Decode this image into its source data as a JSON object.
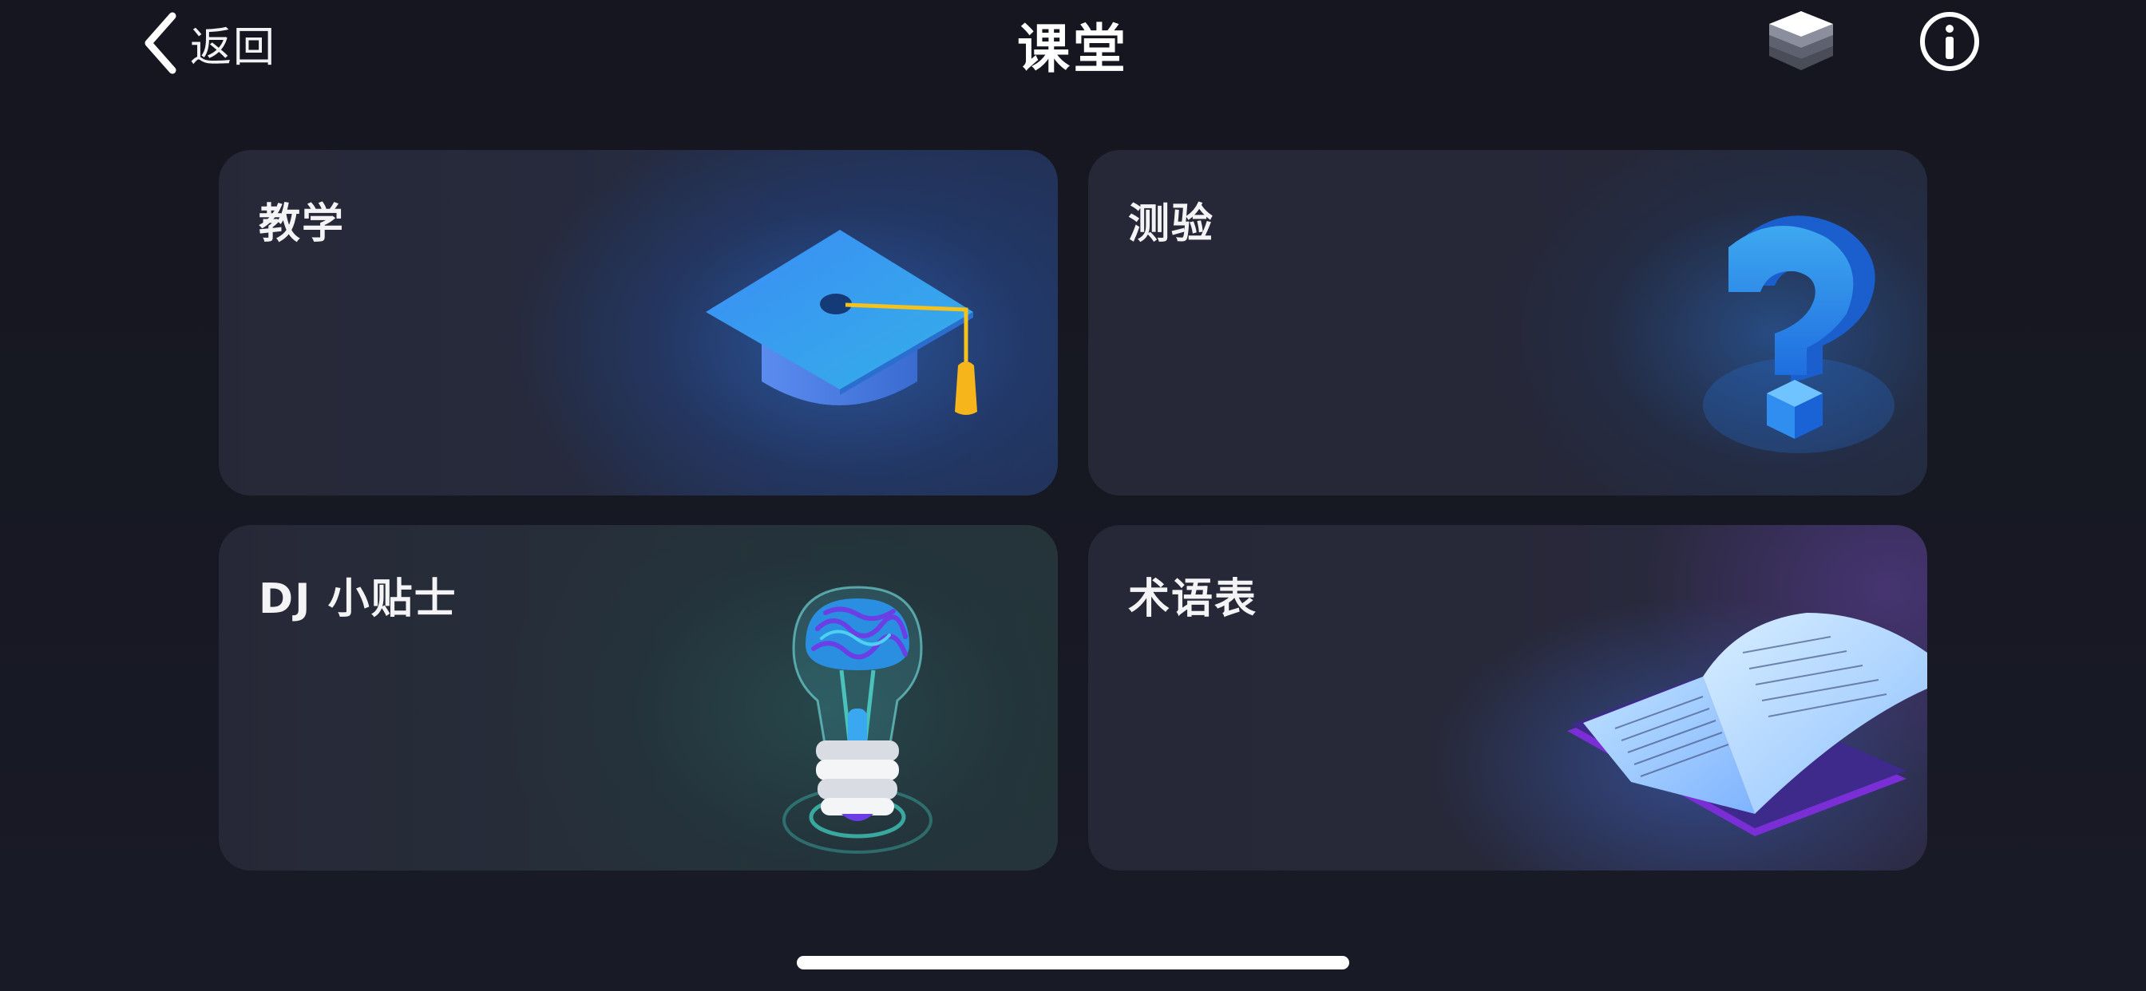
{
  "header": {
    "back_label": "返回",
    "title": "课堂",
    "layers_icon": "layers-icon",
    "info_icon": "info-icon"
  },
  "cards": [
    {
      "id": "teaching",
      "label": "教学",
      "icon": "graduation-cap-icon"
    },
    {
      "id": "quiz",
      "label": "测验",
      "icon": "question-mark-icon"
    },
    {
      "id": "tips",
      "label": "DJ 小贴士",
      "icon": "lightbulb-brain-icon"
    },
    {
      "id": "glossary",
      "label": "术语表",
      "icon": "open-book-icon"
    }
  ],
  "colors": {
    "background": "#15161f",
    "card": "#262736",
    "accent_blue": "#3a86e8",
    "tassel_yellow": "#f5c21b",
    "teal": "#43d8c9",
    "purple": "#8a3cf0"
  }
}
